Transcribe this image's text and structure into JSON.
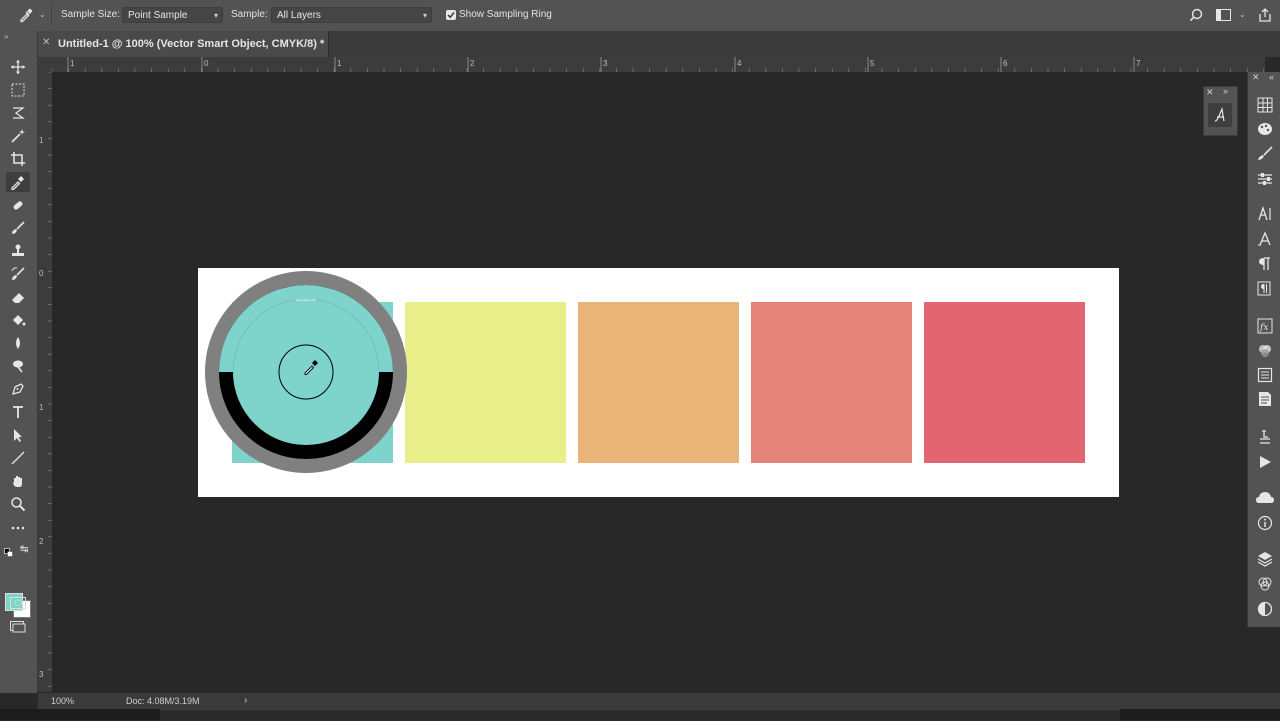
{
  "options_bar": {
    "sample_size_label": "Sample Size:",
    "sample_size_value": "Point Sample",
    "sample_label": "Sample:",
    "sample_value": "All Layers",
    "show_sampling_ring_label": "Show Sampling Ring",
    "show_sampling_ring_checked": true
  },
  "document_tab": {
    "title": "Untitled-1 @ 100% (Vector Smart Object, CMYK/8) *"
  },
  "ruler_h": [
    "1",
    "0",
    "1",
    "2",
    "3",
    "4",
    "5",
    "6",
    "7"
  ],
  "ruler_v": [
    "1",
    "0",
    "1",
    "2",
    "3"
  ],
  "swatches": [
    {
      "name": "teal",
      "color": "#7ed3cb"
    },
    {
      "name": "yellow",
      "color": "#e8ee8a"
    },
    {
      "name": "orange",
      "color": "#e9b477"
    },
    {
      "name": "salmon",
      "color": "#e48378"
    },
    {
      "name": "pink",
      "color": "#e16672"
    }
  ],
  "sampling_ring": {
    "new_color": "#7ed3cb",
    "current_color": "#000000",
    "ring_color": "#808080"
  },
  "foreground_color": "#7ed3cb",
  "background_color": "#ffffff",
  "status_bar": {
    "zoom": "100%",
    "doc_info": "Doc: 4.08M/3.19M"
  },
  "toolbar_tools": [
    "move-icon",
    "marquee-icon",
    "lasso-icon",
    "magic-wand-icon",
    "crop-icon",
    "eyedropper-icon",
    "healing-brush-icon",
    "brush-icon",
    "stamp-icon",
    "history-brush-icon",
    "eraser-icon",
    "paint-bucket-icon",
    "blur-icon",
    "dodge-icon",
    "pen-icon",
    "type-icon",
    "path-selection-icon",
    "line-icon",
    "hand-icon",
    "zoom-icon",
    "more-tools-icon"
  ],
  "right_panel_icons": [
    "grid-icon",
    "paint-palette-icon",
    "brush-settings-icon",
    "adjustments-icon",
    "character-icon",
    "character-styles-icon",
    "paragraph-icon",
    "paragraph-styles-icon",
    "glyphs-icon",
    "color-icon",
    "properties-icon",
    "notes-icon",
    "history-icon",
    "actions-icon",
    "libraries-icon",
    "info-icon",
    "layers-icon",
    "channels-icon",
    "paths-icon"
  ]
}
